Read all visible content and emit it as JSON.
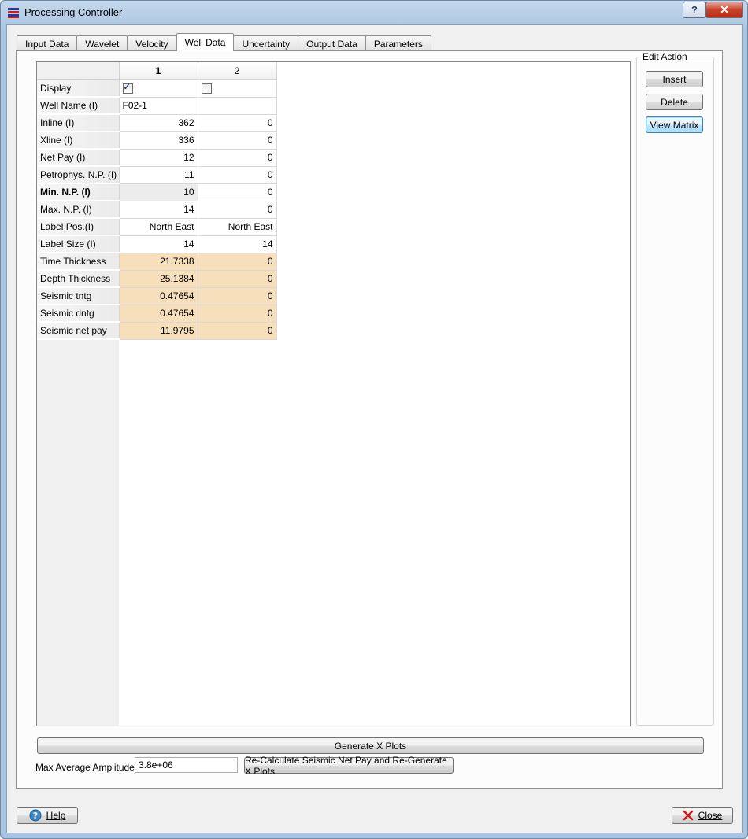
{
  "window": {
    "title": "Processing Controller",
    "help_glyph": "?",
    "close_glyph": "✕"
  },
  "tabs": [
    {
      "label": "Input Data"
    },
    {
      "label": "Wavelet"
    },
    {
      "label": "Velocity"
    },
    {
      "label": "Well Data",
      "active": true
    },
    {
      "label": "Uncertainty"
    },
    {
      "label": "Output Data"
    },
    {
      "label": "Parameters"
    }
  ],
  "grid": {
    "columns": [
      "1",
      "2"
    ],
    "selected_column": "1",
    "rows": [
      {
        "label": "Display",
        "type": "checkbox",
        "values": [
          true,
          false
        ]
      },
      {
        "label": "Well Name (I)",
        "values": [
          "F02-1",
          ""
        ],
        "align": "left"
      },
      {
        "label": "Inline (I)",
        "values": [
          "362",
          "0"
        ]
      },
      {
        "label": "Xline (I)",
        "values": [
          "336",
          "0"
        ]
      },
      {
        "label": "Net Pay (I)",
        "values": [
          "12",
          "0"
        ]
      },
      {
        "label": "Petrophys. N.P. (I)",
        "values": [
          "11",
          "0"
        ]
      },
      {
        "label": "Min. N.P. (I)",
        "values": [
          "10",
          "0"
        ],
        "selected": true
      },
      {
        "label": "Max. N.P. (I)",
        "values": [
          "14",
          "0"
        ]
      },
      {
        "label": "Label Pos.(I)",
        "values": [
          "North East",
          "North East"
        ]
      },
      {
        "label": "Label Size (I)",
        "values": [
          "14",
          "14"
        ]
      },
      {
        "label": "Time Thickness",
        "values": [
          "21.7338",
          "0"
        ],
        "computed": true
      },
      {
        "label": "Depth Thickness",
        "values": [
          "25.1384",
          "0"
        ],
        "computed": true
      },
      {
        "label": "Seismic tntg",
        "values": [
          "0.47654",
          "0"
        ],
        "computed": true
      },
      {
        "label": "Seismic dntg",
        "values": [
          "0.47654",
          "0"
        ],
        "computed": true
      },
      {
        "label": "Seismic net pay",
        "values": [
          "11.9795",
          "0"
        ],
        "computed": true
      }
    ],
    "computed_color": "#f8dfbb"
  },
  "edit_action": {
    "title": "Edit Action",
    "insert_label": "Insert",
    "delete_label": "Delete",
    "view_matrix_label": "View Matrix"
  },
  "generate_label": "Generate X Plots",
  "amplitude": {
    "label": "Max Average Amplitude:",
    "value": "3.8e+06",
    "recalc_label": "Re-Calculate Seismic Net Pay and Re-Generate X Plots"
  },
  "footer": {
    "help_label": "Help",
    "close_label": "Close"
  }
}
